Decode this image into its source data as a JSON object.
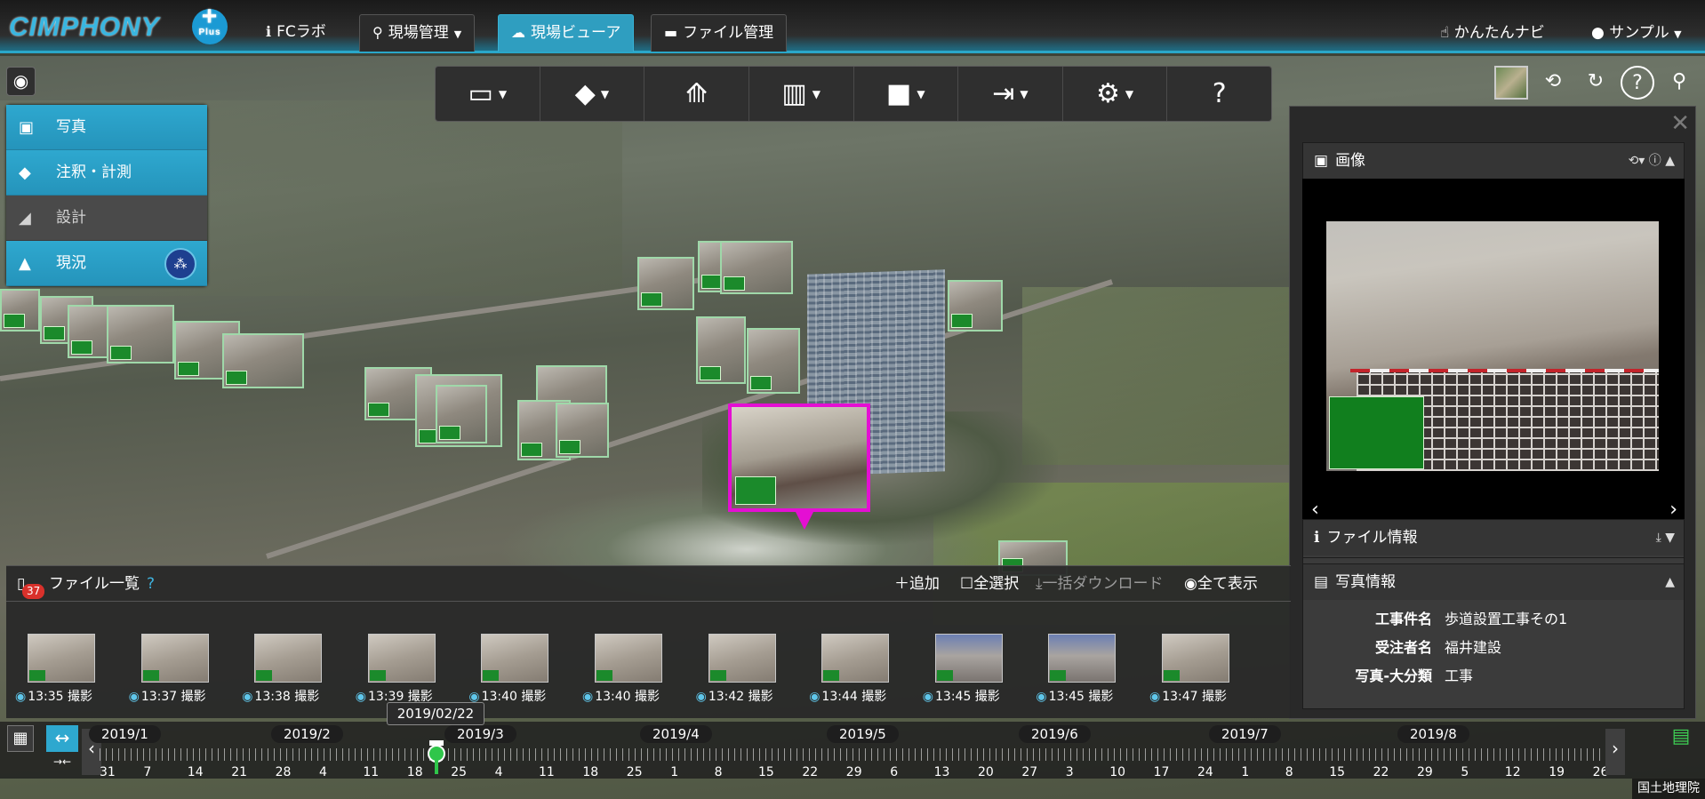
{
  "app": {
    "logo": "CIMPHONY",
    "logo_sub": "Plus"
  },
  "nav": {
    "tabs": [
      {
        "label": "FCラボ"
      },
      {
        "label": "現場管理"
      },
      {
        "label": "現場ビューア"
      },
      {
        "label": "ファイル管理"
      }
    ],
    "guide": "かんたんナビ",
    "user": "サンプル"
  },
  "layers": [
    {
      "label": "写真",
      "state": "on"
    },
    {
      "label": "注釈・計測",
      "state": "on"
    },
    {
      "label": "設計",
      "state": "off"
    },
    {
      "label": "現況",
      "state": "on"
    }
  ],
  "toolbar": [
    "measure",
    "annotation",
    "tower",
    "chart",
    "camera",
    "export",
    "settings",
    "help"
  ],
  "panel": {
    "image_title": "画像",
    "file_info_title": "ファイル情報",
    "photo_info_title": "写真情報",
    "photo_info": [
      {
        "k": "工事件名",
        "v": "歩道設置工事その1"
      },
      {
        "k": "受注者名",
        "v": "福井建設"
      },
      {
        "k": "写真-大分類",
        "v": "工事"
      }
    ]
  },
  "filelist": {
    "title": "ファイル一覧",
    "count": "37",
    "add": "追加",
    "select_all": "全選択",
    "bulk_download": "一括ダウンロード",
    "show_all": "全て表示",
    "items": [
      {
        "time": "13:35 撮影"
      },
      {
        "time": "13:37 撮影"
      },
      {
        "time": "13:38 撮影"
      },
      {
        "time": "13:39 撮影"
      },
      {
        "time": "13:40 撮影"
      },
      {
        "time": "13:40 撮影"
      },
      {
        "time": "13:42 撮影"
      },
      {
        "time": "13:44 撮影"
      },
      {
        "time": "13:45 撮影"
      },
      {
        "time": "13:45 撮影"
      },
      {
        "time": "13:47 撮影"
      }
    ]
  },
  "timeline": {
    "tooltip": "2019/02/22",
    "months": [
      "2019/1",
      "2019/2",
      "2019/3",
      "2019/4",
      "2019/5",
      "2019/6",
      "2019/7",
      "2019/8"
    ],
    "days": [
      "31",
      "7",
      "14",
      "21",
      "28",
      "4",
      "11",
      "18",
      "25",
      "4",
      "11",
      "18",
      "25",
      "1",
      "8",
      "15",
      "22",
      "29",
      "6",
      "13",
      "20",
      "27",
      "3",
      "10",
      "17",
      "24",
      "1",
      "8",
      "15",
      "22",
      "29",
      "5",
      "12",
      "19",
      "26"
    ]
  },
  "attribution": "国土地理院"
}
